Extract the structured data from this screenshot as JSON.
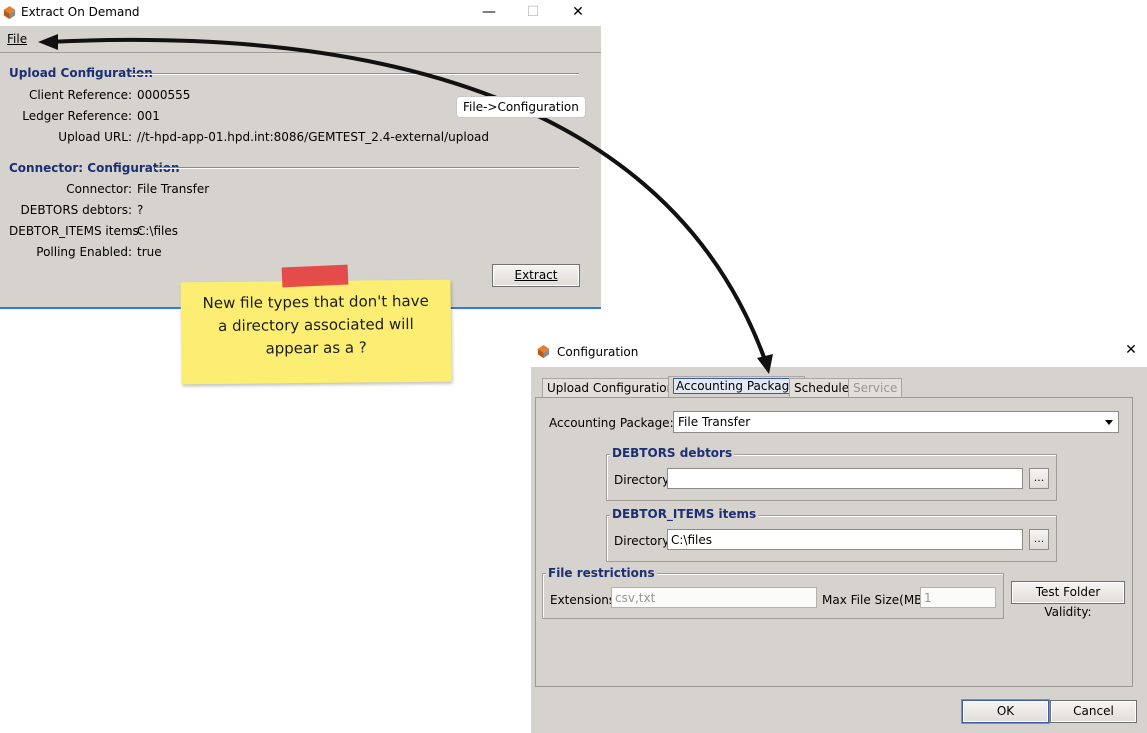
{
  "main_window": {
    "title": "Extract On Demand",
    "caption_minimize": "—",
    "caption_maximize": "☐",
    "caption_close": "✕",
    "menu": {
      "file": "File"
    },
    "upload_section": {
      "title": "Upload Configuration",
      "rows": [
        {
          "label": "Client Reference:",
          "value": "0000555"
        },
        {
          "label": "Ledger Reference:",
          "value": "001"
        },
        {
          "label": "Upload URL:",
          "value": "//t-hpd-app-01.hpd.int:8086/GEMTEST_2.4-external/upload"
        }
      ]
    },
    "connector_section": {
      "title": "Connector: Configuration",
      "rows": [
        {
          "label": "Connector:",
          "value": "File Transfer"
        },
        {
          "label": "DEBTORS debtors:",
          "value": "?"
        },
        {
          "label": "DEBTOR_ITEMS items:",
          "value": "C:\\files"
        },
        {
          "label": "Polling Enabled:",
          "value": "true"
        }
      ]
    },
    "extract_button": "Extract"
  },
  "annotations": {
    "callout": "File->Configuration",
    "sticky_note": "New file types that don't have\na directory associated will\nappear as a ?",
    "sticky_color": "#fcee72",
    "tape_color": "#e54040"
  },
  "config_window": {
    "title": "Configuration",
    "caption_close": "✕",
    "tabs": [
      {
        "label": "Upload Configuration",
        "state": "normal"
      },
      {
        "label": "Accounting Package",
        "state": "selected"
      },
      {
        "label": "Schedule",
        "state": "normal"
      },
      {
        "label": "Service",
        "state": "disabled"
      }
    ],
    "accounting_package": {
      "label": "Accounting Package:",
      "selected": "File Transfer"
    },
    "debtors_group": {
      "title": "DEBTORS  debtors",
      "directory_label": "Directory",
      "directory_value": "",
      "browse_label": "..."
    },
    "debtor_items_group": {
      "title": "DEBTOR_ITEMS  items",
      "directory_label": "Directory",
      "directory_value": "C:\\files",
      "browse_label": "..."
    },
    "file_restrictions": {
      "title": "File restrictions",
      "extensions_label": "Extensions",
      "extensions_value": "csv,txt",
      "max_size_label": "Max File Size(MB)",
      "max_size_value": "1"
    },
    "test_button": "Test Folder Validity:",
    "ok_button": "OK",
    "cancel_button": "Cancel"
  },
  "colors": {
    "window_background": "#d6d3ce",
    "section_title": "#1c2f73",
    "selection_border": "#3d5ca7"
  }
}
